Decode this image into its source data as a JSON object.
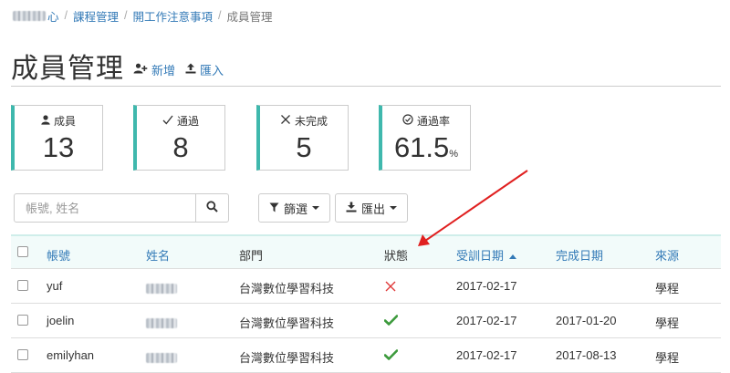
{
  "breadcrumb": {
    "items": [
      {
        "label": "心",
        "link": true
      },
      {
        "label": "課程管理",
        "link": true
      },
      {
        "label": "開工作注意事項",
        "link": true
      },
      {
        "label": "成員管理",
        "link": false
      }
    ]
  },
  "header": {
    "title": "成員管理",
    "add_label": "新增",
    "import_label": "匯入"
  },
  "stats": [
    {
      "icon": "user-icon",
      "label": "成員",
      "value": "13",
      "suffix": ""
    },
    {
      "icon": "check-icon",
      "label": "通過",
      "value": "8",
      "suffix": ""
    },
    {
      "icon": "x-icon",
      "label": "未完成",
      "value": "5",
      "suffix": ""
    },
    {
      "icon": "check-circle-icon",
      "label": "通過率",
      "value": "61.5",
      "suffix": "%"
    }
  ],
  "toolbar": {
    "search_placeholder": "帳號, 姓名",
    "filter_label": "篩選",
    "export_label": "匯出"
  },
  "table": {
    "columns": [
      "帳號",
      "姓名",
      "部門",
      "狀態",
      "受訓日期",
      "完成日期",
      "來源"
    ],
    "sorted_column": "受訓日期",
    "rows": [
      {
        "account": "yuf",
        "department": "台灣數位學習科技",
        "status": "fail",
        "train_date": "2017-02-17",
        "complete_date": "",
        "source": "學程"
      },
      {
        "account": "joelin",
        "department": "台灣數位學習科技",
        "status": "pass",
        "train_date": "2017-02-17",
        "complete_date": "2017-01-20",
        "source": "學程"
      },
      {
        "account": "emilyhan",
        "department": "台灣數位學習科技",
        "status": "pass",
        "train_date": "2017-02-17",
        "complete_date": "2017-08-13",
        "source": "學程"
      }
    ]
  },
  "colors": {
    "link": "#337ab7",
    "accent": "#3fb8ad",
    "fail": "#e03a3a",
    "pass": "#3c9a3c",
    "annotation_arrow": "#e02020"
  }
}
